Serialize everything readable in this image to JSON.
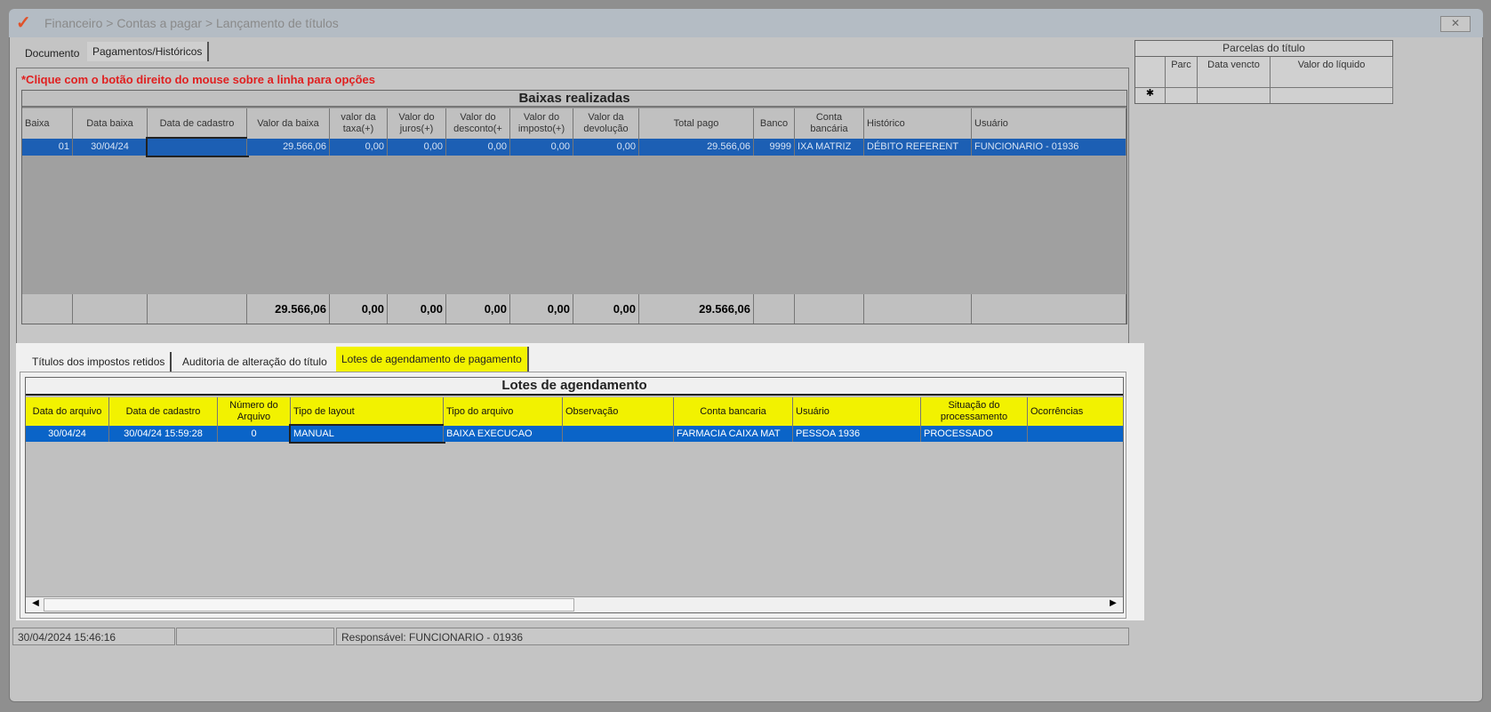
{
  "window": {
    "title": "Financeiro > Contas a pagar > Lançamento de títulos",
    "close": "✕"
  },
  "tabs": [
    "Documento",
    "Pagamentos/Históricos"
  ],
  "hint": "*Clique com o botão direito do mouse sobre a linha para opções",
  "baixas": {
    "title": "Baixas realizadas",
    "columns": [
      "Baixa",
      "Data baixa",
      "Data de cadastro",
      "Valor da baixa",
      "valor da taxa(+)",
      "Valor do juros(+)",
      "Valor do desconto(+",
      "Valor do imposto(+)",
      "Valor da devolução",
      "Total pago",
      "Banco",
      "Conta bancária",
      "Histórico",
      "Usuário"
    ],
    "rows": [
      [
        "01",
        "30/04/24",
        "",
        "29.566,06",
        "0,00",
        "0,00",
        "0,00",
        "0,00",
        "0,00",
        "29.566,06",
        "9999",
        "IXA MATRIZ",
        "DÉBITO REFERENT",
        "FUNCIONARIO - 01936"
      ]
    ],
    "totals": [
      "",
      "",
      "",
      "29.566,06",
      "0,00",
      "0,00",
      "0,00",
      "0,00",
      "0,00",
      "29.566,06",
      "",
      "",
      "",
      ""
    ]
  },
  "sub_tabs": [
    "Títulos dos impostos retidos",
    "Auditoria de alteração do título",
    "Lotes de agendamento de pagamento"
  ],
  "lotes": {
    "title": "Lotes de agendamento",
    "columns": [
      "Data do arquivo",
      "Data de cadastro",
      "Número do Arquivo",
      "Tipo de layout",
      "Tipo do arquivo",
      "Observação",
      "Conta bancaria",
      "Usuário",
      "Situação do processamento",
      "Ocorrências"
    ],
    "rows": [
      [
        "30/04/24",
        "30/04/24 15:59:28",
        "0",
        "MANUAL",
        "BAIXA EXECUCAO",
        "",
        "FARMACIA CAIXA MAT",
        "PESSOA 1936",
        "PROCESSADO",
        ""
      ]
    ]
  },
  "parcelas": {
    "title": "Parcelas do título",
    "columns": [
      "",
      "Parc",
      "Data vencto",
      "Valor do líquido"
    ],
    "new_row_marker": "✱"
  },
  "status": {
    "datetime": "30/04/2024 15:46:16",
    "middle": "",
    "responsavel": "Responsável: FUNCIONARIO - 01936"
  },
  "colors": {
    "highlight": "#f2f200",
    "selection": "#0a64c8",
    "hint": "#e02020"
  }
}
